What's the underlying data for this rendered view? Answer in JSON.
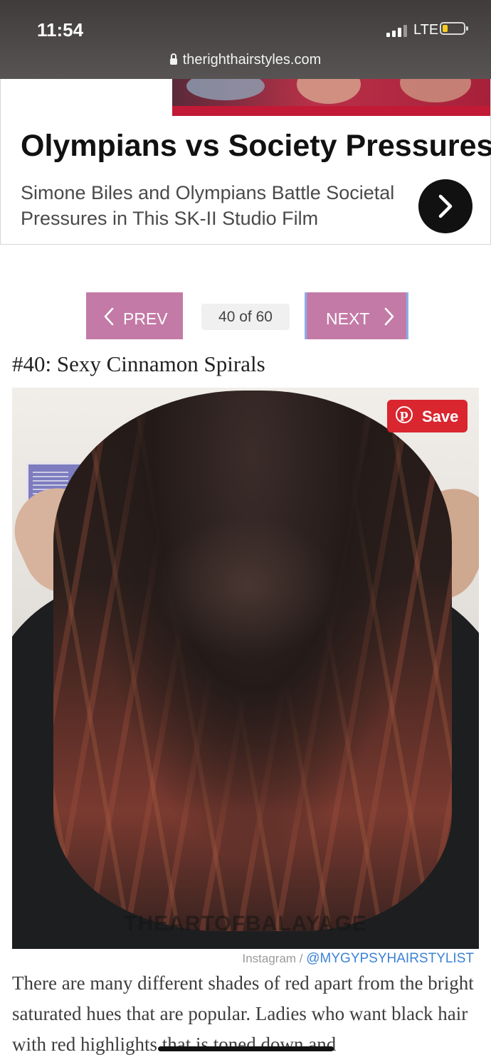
{
  "status_bar": {
    "time": "11:54",
    "network": "LTE",
    "battery_level": 0.25
  },
  "browser": {
    "url": "therighthairstyles.com"
  },
  "ad": {
    "title": "Olympians vs Society Pressures",
    "subtitle": "Simone Biles and Olympians Battle Societal Pressures in This SK-II Studio Film",
    "accent_color": "#c21a36"
  },
  "pager": {
    "prev_label": "PREV",
    "next_label": "NEXT",
    "counter": "40 of 60",
    "button_color": "#c47aa6"
  },
  "article": {
    "item_title": "#40: Sexy Cinnamon Spirals",
    "image_watermark": "THEARTOFBALAYAGE",
    "pin_save_label": "Save",
    "credit_source": "Instagram /",
    "credit_handle": "@MYGYPSYHAIRSTYLIST",
    "body": "There are many different shades of red apart from the bright saturated hues that are popular. Ladies who want black hair with red highlights that is toned down and"
  }
}
